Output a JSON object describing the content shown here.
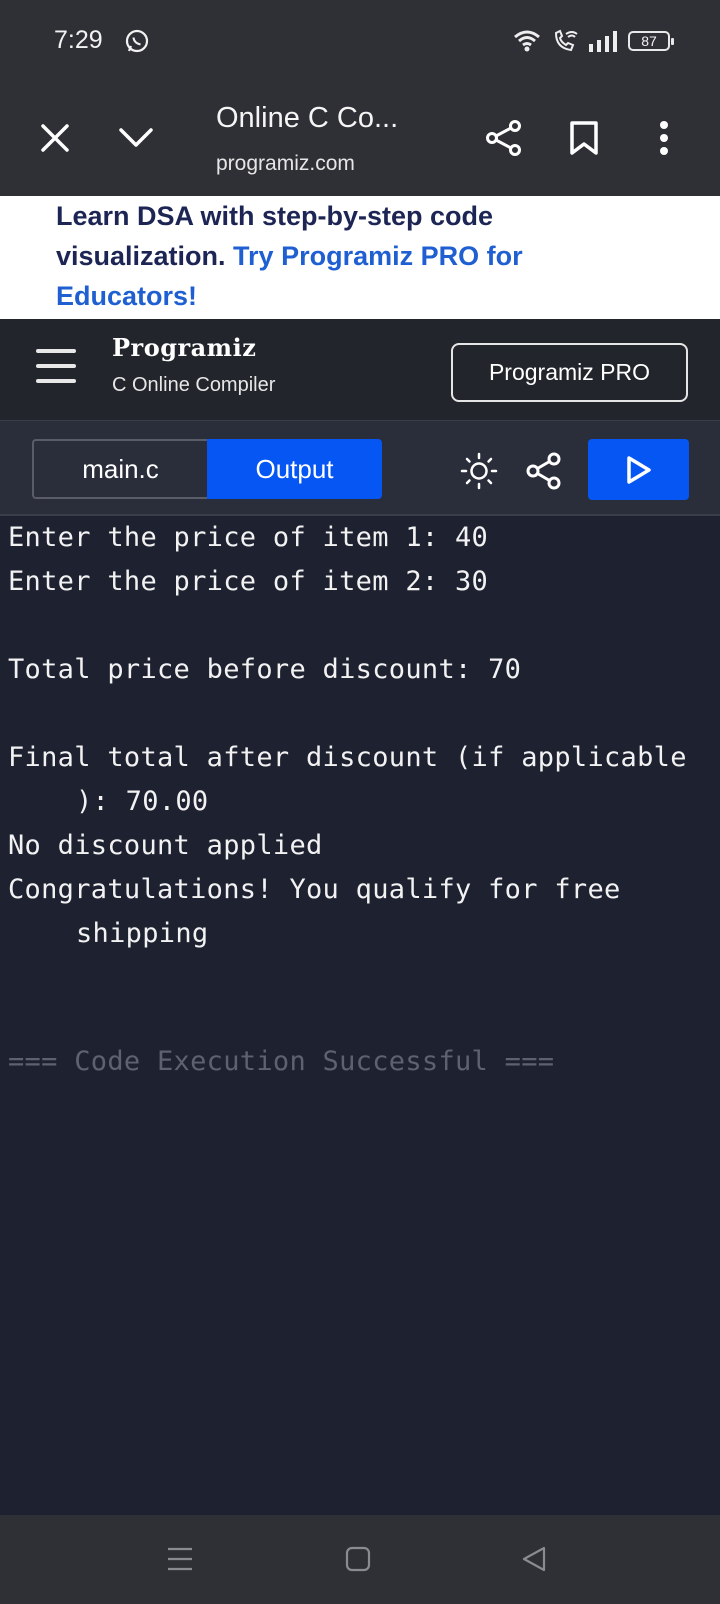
{
  "status": {
    "time": "7:29",
    "battery": "87"
  },
  "browser": {
    "title": "Online C Co...",
    "domain": "programiz.com"
  },
  "banner": {
    "text": "Learn DSA with step-by-step code visualization. ",
    "link": "Try Programiz PRO for Educators!"
  },
  "site": {
    "logo": "Programiz",
    "subtitle": "C Online Compiler",
    "pro_button": "Programiz PRO"
  },
  "toolbar": {
    "tab_main": "main.c",
    "tab_output": "Output"
  },
  "output": {
    "lines": [
      "Enter the price of item 1: 40",
      "Enter the price of item 2: 30",
      "Total price before discount: 70",
      "Final total after discount (if applicable",
      "): 70.00",
      "No discount applied",
      "Congratulations! You qualify for free",
      "shipping",
      "=== Code Execution Successful ==="
    ]
  },
  "colors": {
    "accent": "#0556f3",
    "link": "#1f5fd1",
    "output_bg": "#1e2130",
    "chrome_bg": "#2f3036"
  }
}
